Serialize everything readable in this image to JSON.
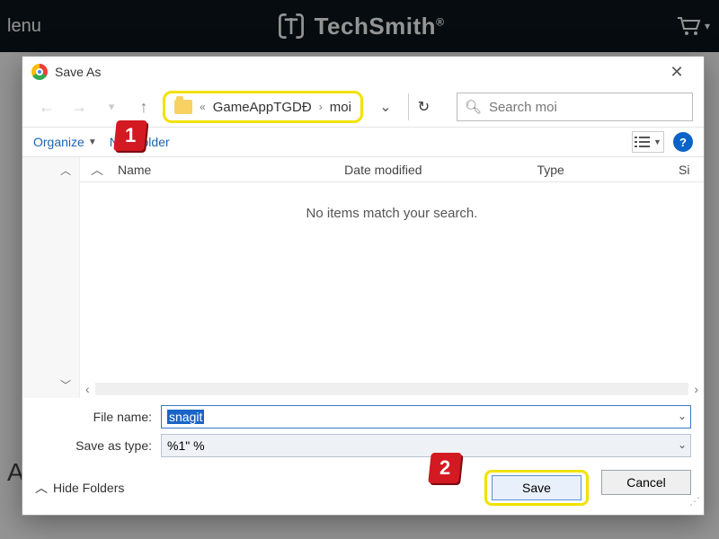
{
  "header": {
    "menu_label": "lenu",
    "brand": "TechSmith",
    "page_letter": "A"
  },
  "dialog": {
    "title": "Save As",
    "path": {
      "prefix": "«",
      "parent": "GameAppTGDĐ",
      "current": "moi"
    },
    "search_placeholder": "Search moi",
    "toolbar": {
      "organize": "Organize",
      "new_folder": "New folder"
    },
    "columns": {
      "name": "Name",
      "date": "Date modified",
      "type": "Type",
      "size": "Si"
    },
    "empty_message": "No items match your search.",
    "filename_label": "File name:",
    "filename_value": "snagit",
    "saveastype_label": "Save as type:",
    "saveastype_value": "%1\" %",
    "hide_folders": "Hide Folders",
    "save_label": "Save",
    "cancel_label": "Cancel"
  },
  "annotations": {
    "one": "1",
    "two": "2"
  }
}
